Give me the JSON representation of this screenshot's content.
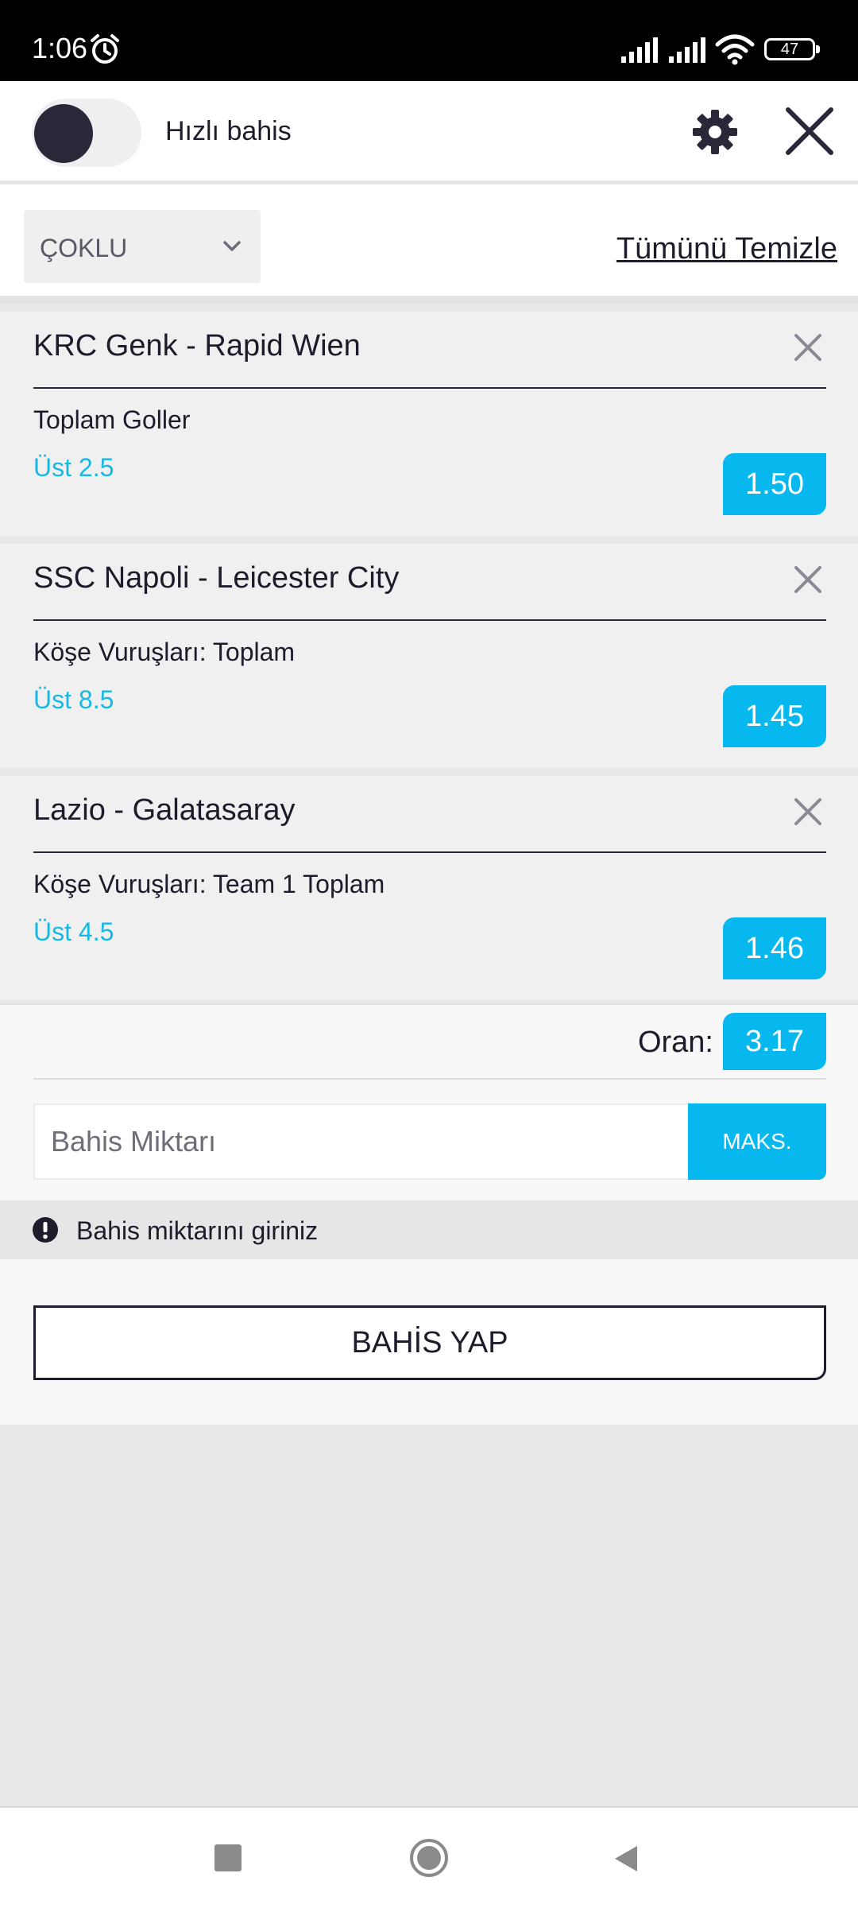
{
  "status_bar": {
    "time": "1:06",
    "battery": "47"
  },
  "header": {
    "quick_bet_label": "Hızlı bahis"
  },
  "mode_bar": {
    "mode": "ÇOKLU",
    "clear_all": "Tümünü Temizle"
  },
  "bets": [
    {
      "match": "KRC Genk - Rapid Wien",
      "market": "Toplam Goller",
      "selection": "Üst 2.5",
      "odds": "1.50"
    },
    {
      "match": "SSC Napoli - Leicester City",
      "market": "Köşe Vuruşları: Toplam",
      "selection": "Üst 8.5",
      "odds": "1.45"
    },
    {
      "match": "Lazio - Galatasaray",
      "market": "Köşe Vuruşları: Team 1 Toplam",
      "selection": "Üst 4.5",
      "odds": "1.46"
    }
  ],
  "summary": {
    "total_odds_label": "Oran:",
    "total_odds": "3.17",
    "stake_placeholder": "Bahis Miktarı",
    "max_label": "MAKS."
  },
  "warning": {
    "text": "Bahis miktarını giriniz"
  },
  "place_bet": {
    "label": "BAHİS YAP"
  },
  "colors": {
    "accent": "#07b8ee",
    "selection_text": "#16b8e4",
    "dark": "#1c1c2b"
  }
}
